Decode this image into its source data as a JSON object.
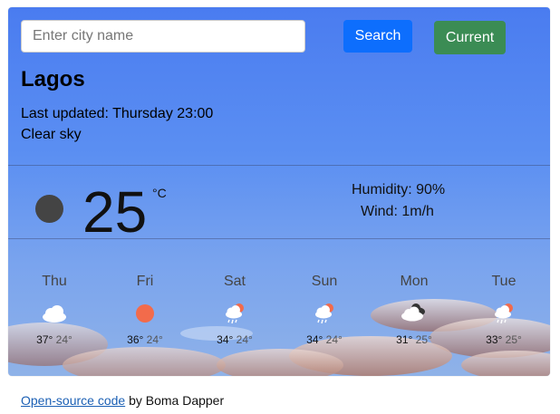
{
  "search": {
    "placeholder": "Enter city name",
    "value": ""
  },
  "buttons": {
    "search_label": "Search",
    "current_label": "Current"
  },
  "location": {
    "city": "Lagos",
    "last_updated": "Last updated: Thursday 23:00",
    "condition": "Clear sky"
  },
  "current": {
    "temperature": "25",
    "unit": "°C",
    "humidity": "Humidity: 90%",
    "wind": "Wind: 1m/h",
    "icon": "moon-icon"
  },
  "forecast": [
    {
      "day": "Thu",
      "high": "37°",
      "low": "24°",
      "icon": "cloud-icon"
    },
    {
      "day": "Fri",
      "high": "36°",
      "low": "24°",
      "icon": "sun-icon"
    },
    {
      "day": "Sat",
      "high": "34°",
      "low": "24°",
      "icon": "sun-rain-cloud-icon"
    },
    {
      "day": "Sun",
      "high": "34°",
      "low": "24°",
      "icon": "sun-rain-cloud-icon"
    },
    {
      "day": "Mon",
      "high": "31°",
      "low": "25°",
      "icon": "dark-cloud-icon"
    },
    {
      "day": "Tue",
      "high": "33°",
      "low": "25°",
      "icon": "sun-rain-cloud-icon"
    }
  ],
  "footer": {
    "link_text": "Open-source code",
    "suffix": " by Boma Dapper"
  },
  "colors": {
    "search_button": "#0d6efd",
    "current_button": "#3b8c54",
    "sun": "#f26b4b",
    "moon": "#444444"
  }
}
